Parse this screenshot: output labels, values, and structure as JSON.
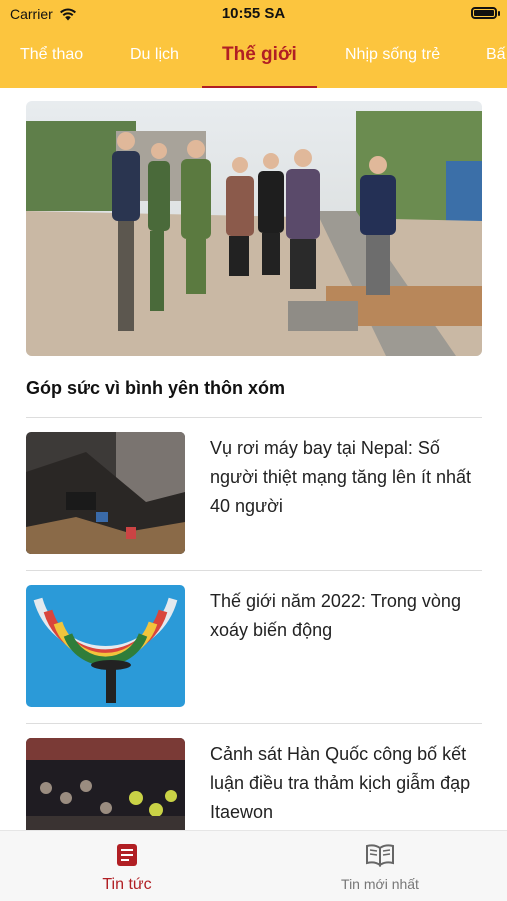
{
  "status": {
    "carrier": "Carrier",
    "time": "10:55 SA"
  },
  "tabs": [
    {
      "label": "Thể thao"
    },
    {
      "label": "Du lịch"
    },
    {
      "label": "Thế giới"
    },
    {
      "label": "Nhịp sống trẻ"
    },
    {
      "label": "Bấ"
    }
  ],
  "active_tab": "Thế giới",
  "hero": {
    "title": "Góp sức vì bình yên thôn xóm"
  },
  "articles": [
    {
      "title": "Vụ rơi máy bay tại Nepal: Số người thiệt mạng tăng lên ít nhất 40 người"
    },
    {
      "title": "Thế giới năm 2022: Trong vòng xoáy biến động"
    },
    {
      "title": "Cảnh sát Hàn Quốc công bố kết luận điều tra thảm kịch giẫm đạp Itaewon"
    }
  ],
  "bottom_nav": [
    {
      "label": "Tin tức",
      "icon": "newspaper-icon"
    },
    {
      "label": "Tin mới nhất",
      "icon": "open-book-icon"
    }
  ],
  "colors": {
    "header": "#fcc53e",
    "accent": "#b11f24",
    "inactive": "#777777"
  }
}
